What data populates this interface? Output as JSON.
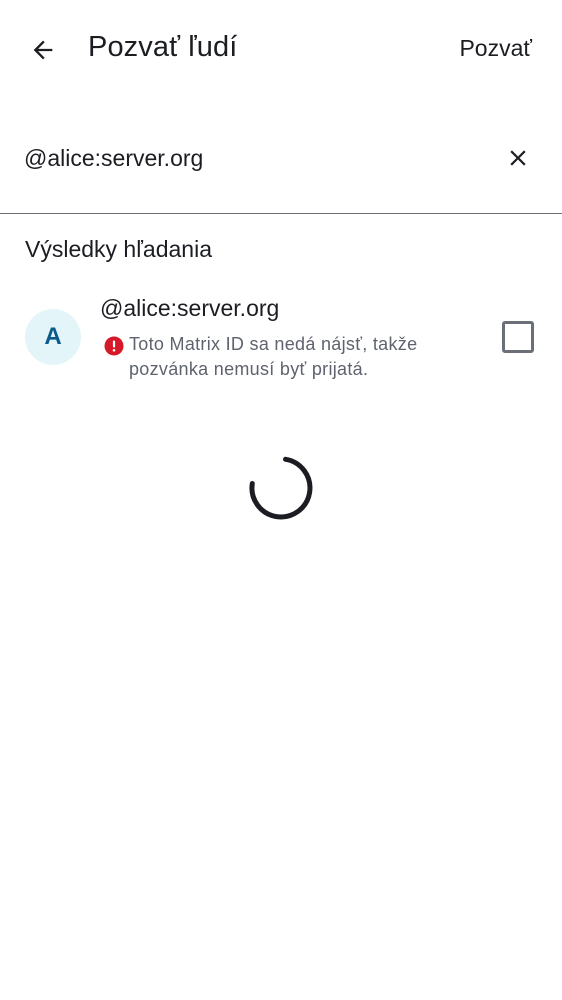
{
  "header": {
    "title": "Pozvať ľudí",
    "invite_label": "Pozvať",
    "back_icon": "arrow-left-icon"
  },
  "search": {
    "value": "@alice:server.org",
    "placeholder": "",
    "clear_icon": "close-icon"
  },
  "results": {
    "section_title": "Výsledky hľadania",
    "items": [
      {
        "avatar_letter": "A",
        "name": "@alice:server.org",
        "warning": "Toto Matrix ID sa nedá nájsť, takže pozvánka nemusí byť prijatá.",
        "selected": false
      }
    ]
  },
  "colors": {
    "text": "#1b1d22",
    "secondary_text": "#5e636d",
    "avatar_bg": "#e3f5f8",
    "avatar_fg": "#0a5b8b",
    "error": "#d51928",
    "divider": "#6b6f78"
  },
  "loading": true
}
